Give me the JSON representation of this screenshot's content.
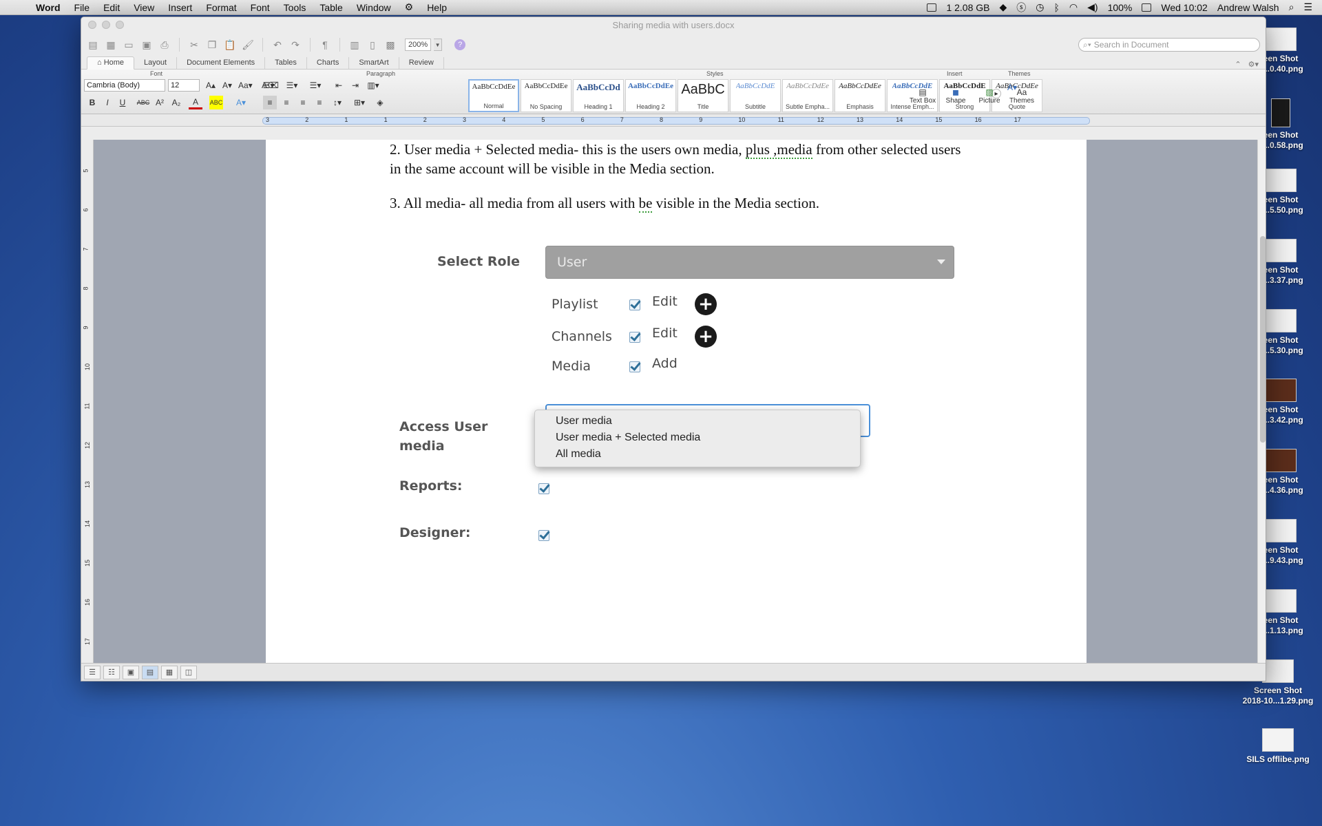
{
  "menubar": {
    "app_name": "Word",
    "items": [
      "File",
      "Edit",
      "View",
      "Insert",
      "Format",
      "Font",
      "Tools",
      "Table",
      "Window",
      "Help"
    ],
    "memory": "1 2.08 GB",
    "battery": "100%",
    "clock": "Wed 10:02",
    "user": "Andrew Walsh"
  },
  "window": {
    "title": "Sharing media with users.docx",
    "zoom": "200%",
    "search_placeholder": "Search in Document"
  },
  "ribbon": {
    "tabs": [
      "Home",
      "Layout",
      "Document Elements",
      "Tables",
      "Charts",
      "SmartArt",
      "Review"
    ],
    "groups": {
      "font": "Font",
      "paragraph": "Paragraph",
      "styles": "Styles",
      "insert": "Insert",
      "themes": "Themes"
    },
    "font_name": "Cambria (Body)",
    "font_size": "12",
    "styles": [
      {
        "sample": "AaBbCcDdEe",
        "name": "Normal"
      },
      {
        "sample": "AaBbCcDdEe",
        "name": "No Spacing"
      },
      {
        "sample": "AaBbCcDd",
        "name": "Heading 1"
      },
      {
        "sample": "AaBbCcDdEe",
        "name": "Heading 2"
      },
      {
        "sample": "AaBbC",
        "name": "Title"
      },
      {
        "sample": "AaBbCcDdE",
        "name": "Subtitle"
      },
      {
        "sample": "AaBbCcDdEe",
        "name": "Subtle Empha..."
      },
      {
        "sample": "AaBbCcDdEe",
        "name": "Emphasis"
      },
      {
        "sample": "AaBbCcDdE",
        "name": "Intense Emph..."
      },
      {
        "sample": "AaBbCcDdE",
        "name": "Strong"
      },
      {
        "sample": "AaBbCcDdEe",
        "name": "Quote"
      }
    ],
    "insert_items": [
      "Text Box",
      "Shape",
      "Picture"
    ],
    "themes_label": "Themes"
  },
  "ruler_numbers": [
    "3",
    "2",
    "1",
    "1",
    "2",
    "3",
    "4",
    "5",
    "6",
    "7",
    "8",
    "9",
    "10",
    "11",
    "12",
    "13",
    "14",
    "15",
    "16",
    "17"
  ],
  "vruler_numbers": [
    "5",
    "6",
    "7",
    "8",
    "9",
    "10",
    "11",
    "12",
    "13",
    "14",
    "15",
    "16",
    "17"
  ],
  "document": {
    "para2_a": "2. User media + Selected media- this is the users own media, ",
    "para2_squiggle": "plus ,media",
    "para2_b": " from other selected users in the same account will be visible in the Media section.",
    "para3_a": "3. All media- all media from all users with ",
    "para3_squiggle": "be",
    "para3_b": " visible in the Media section."
  },
  "embedded": {
    "select_role_label": "Select Role",
    "role_value": "User",
    "permissions": [
      {
        "label": "Playlist",
        "action": "Edit"
      },
      {
        "label": "Channels",
        "action": "Edit"
      },
      {
        "label": "Media",
        "action": "Add"
      }
    ],
    "access_label_1": "Access User",
    "access_label_2": "media",
    "access_options": [
      "User media",
      "User media + Selected media",
      "All media"
    ],
    "reports_label": "Reports:",
    "designer_label": "Designer:"
  },
  "desktop_files": [
    {
      "line1": "een Shot",
      "line2": "0...0.40.png"
    },
    {
      "line1": "een Shot",
      "line2": "0...0.58.png"
    },
    {
      "line1": "een Shot",
      "line2": "0...5.50.png"
    },
    {
      "line1": "een Shot",
      "line2": "0...3.37.png"
    },
    {
      "line1": "een Shot",
      "line2": "0...5.30.png"
    },
    {
      "line1": "een Shot",
      "line2": "0...3.42.png"
    },
    {
      "line1": "een Shot",
      "line2": "0...4.36.png"
    },
    {
      "line1": "een Shot",
      "line2": "0...9.43.png"
    },
    {
      "line1": "een Shot",
      "line2": "0...1.13.png"
    },
    {
      "line1": "Screen Shot",
      "line2": "2018-10...1.29.png"
    },
    {
      "line1": "SILS offlibe.png",
      "line2": ""
    }
  ]
}
